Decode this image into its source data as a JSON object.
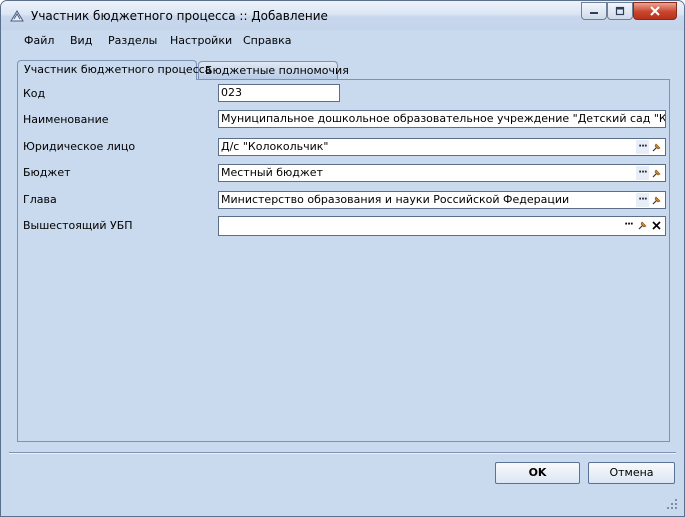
{
  "window": {
    "title": "Участник бюджетного процесса :: Добавление"
  },
  "menu": [
    "Файл",
    "Вид",
    "Разделы",
    "Настройки",
    "Справка"
  ],
  "tabs": [
    {
      "label": "Участник бюджетного процесса",
      "active": true
    },
    {
      "label": "Бюджетные полномочия",
      "active": false
    }
  ],
  "form": {
    "code": {
      "label": "Код",
      "value": "023"
    },
    "name": {
      "label": "Наименование",
      "value": "Муниципальное дошкольное образовательное учреждение \"Детский сад \"Колокольчик\""
    },
    "legal_entity": {
      "label": "Юридическое лицо",
      "value": "Д/с \"Колокольчик\""
    },
    "budget": {
      "label": "Бюджет",
      "value": "Местный бюджет"
    },
    "head": {
      "label": "Глава",
      "value": "Министерство образования и науки Российской Федерации"
    },
    "parent_ubp": {
      "label": "Вышестоящий УБП",
      "value": ""
    }
  },
  "buttons": {
    "ok": "OK",
    "cancel": "Отмена"
  },
  "colors": {
    "window_bg": "#c9d9ee",
    "border": "#5d6f88",
    "close": "#c9452c"
  }
}
